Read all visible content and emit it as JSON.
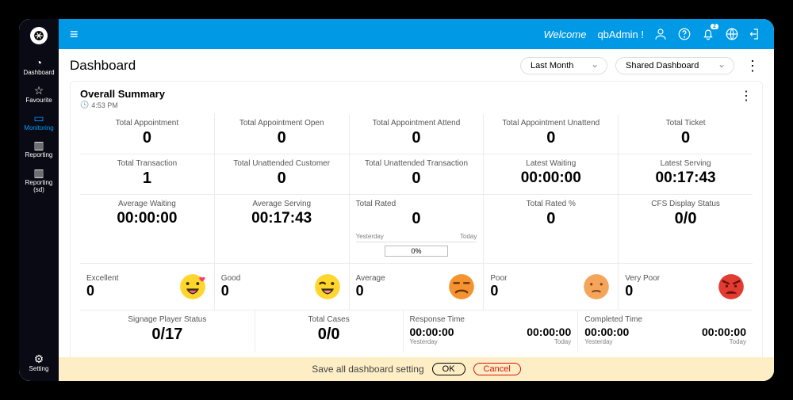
{
  "topbar": {
    "welcome_prefix": "Welcome",
    "username": "qbAdmin !",
    "bell_badge": "2"
  },
  "rail": {
    "items": [
      {
        "id": "dashboard",
        "label": "Dashboard"
      },
      {
        "id": "favourite",
        "label": "Favourite"
      },
      {
        "id": "monitoring",
        "label": "Monitoring"
      },
      {
        "id": "reporting",
        "label": "Reporting"
      },
      {
        "id": "reporting-sd",
        "label": "Reporting (sd)"
      }
    ],
    "bottom": {
      "id": "setting",
      "label": "Setting"
    }
  },
  "page": {
    "title": "Dashboard",
    "range_select": "Last Month",
    "dashboard_select": "Shared Dashboard"
  },
  "panel": {
    "title": "Overall Summary",
    "time": "4:53 PM"
  },
  "metrics": {
    "row1": [
      {
        "label": "Total Appointment",
        "value": "0"
      },
      {
        "label": "Total Appointment Open",
        "value": "0"
      },
      {
        "label": "Total Appointment Attend",
        "value": "0"
      },
      {
        "label": "Total Appointment Unattend",
        "value": "0"
      },
      {
        "label": "Total Ticket",
        "value": "0"
      }
    ],
    "row2": [
      {
        "label": "Total Transaction",
        "value": "1"
      },
      {
        "label": "Total Unattended Customer",
        "value": "0"
      },
      {
        "label": "Total Unattended Transaction",
        "value": "0"
      },
      {
        "label": "Latest Waiting",
        "value": "00:00:00"
      },
      {
        "label": "Latest Serving",
        "value": "00:17:43"
      }
    ],
    "row3": {
      "avg_waiting": {
        "label": "Average Waiting",
        "value": "00:00:00"
      },
      "avg_serving": {
        "label": "Average Serving",
        "value": "00:17:43"
      },
      "total_rated": {
        "label": "Total Rated",
        "value": "0",
        "yesterday": "Yesterday",
        "today": "Today",
        "pct": "0%"
      },
      "total_rated_pct": {
        "label": "Total Rated %",
        "value": "0"
      },
      "cfs": {
        "label": "CFS Display Status",
        "value": "0/0"
      }
    },
    "ratings": [
      {
        "label": "Excellent",
        "value": "0"
      },
      {
        "label": "Good",
        "value": "0"
      },
      {
        "label": "Average",
        "value": "0"
      },
      {
        "label": "Poor",
        "value": "0"
      },
      {
        "label": "Very Poor",
        "value": "0"
      }
    ],
    "row5": {
      "signage": {
        "label": "Signage Player Status",
        "value": "0/17"
      },
      "cases": {
        "label": "Total Cases",
        "value": "0/0"
      },
      "response": {
        "label": "Response Time",
        "a": "00:00:00",
        "b": "00:00:00",
        "ta": "Yesterday",
        "tb": "Today"
      },
      "completed": {
        "label": "Completed Time",
        "a": "00:00:00",
        "b": "00:00:00",
        "ta": "Yesterday",
        "tb": "Today"
      }
    }
  },
  "savebar": {
    "message": "Save all dashboard setting",
    "ok": "OK",
    "cancel": "Cancel"
  }
}
